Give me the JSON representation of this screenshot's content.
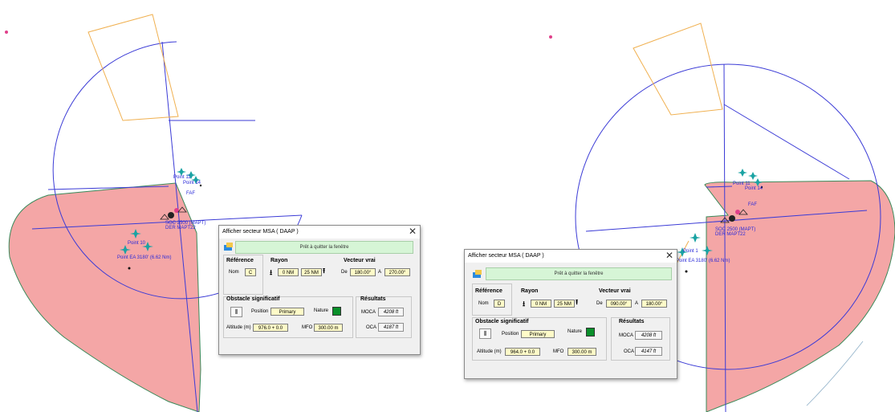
{
  "map": {
    "labels": {
      "point_11": "Point 11",
      "point_10": "Point 10",
      "point_1": "Point 1",
      "faf": "FAF",
      "soc": "SOC 2500 (MAPT)",
      "soc_sub": "DER MAPT22",
      "point_14": "Point 14",
      "pt_short": "Point 1",
      "ea_left": "Point EA 3180' (6.62 Nm)",
      "ea_right": "Point EA 3180' (6.62 Nm)"
    }
  },
  "left_dialog": {
    "title": "Afficher secteur MSA ( DAAP )",
    "close": "✕",
    "status": "Prêt à quitter la fenêtre",
    "reference": {
      "heading": "Référence",
      "nom_label": "Nom",
      "nom_value": "C"
    },
    "rayon": {
      "heading": "Rayon",
      "from": "0 NM",
      "to": "25 NM"
    },
    "vecteur": {
      "heading": "Vecteur vrai",
      "de_label": "De",
      "de_value": "180.00°",
      "a_label": "A",
      "a_value": "270.00°"
    },
    "obstacle": {
      "heading": "Obstacle significatif",
      "position_label": "Position",
      "position_value": "Primary",
      "nature_label": "Nature",
      "altitude_label": "Altitude (m)",
      "altitude_value": "976.0 + 0.0",
      "mfo_label": "MFO",
      "mfo_value": "300.00 m"
    },
    "resultats": {
      "heading": "Résultats",
      "moca_label": "MOCA",
      "moca_value": "4208 ft",
      "oca_label": "OCA",
      "oca_value": "4187 ft"
    }
  },
  "right_dialog": {
    "title": "Afficher secteur MSA ( DAAP )",
    "close": "✕",
    "status": "Prêt à quitter la fenêtre",
    "reference": {
      "heading": "Référence",
      "nom_label": "Nom",
      "nom_value": "D"
    },
    "rayon": {
      "heading": "Rayon",
      "from": "0 NM",
      "to": "25 NM"
    },
    "vecteur": {
      "heading": "Vecteur vrai",
      "de_label": "De",
      "de_value": "090.00°",
      "a_label": "A",
      "a_value": "180.00°"
    },
    "obstacle": {
      "heading": "Obstacle significatif",
      "position_label": "Position",
      "position_value": "Primary",
      "nature_label": "Nature",
      "altitude_label": "Altitude (m)",
      "altitude_value": "964.0 + 0.0",
      "mfo_label": "MFO",
      "mfo_value": "300.00 m"
    },
    "resultats": {
      "heading": "Résultats",
      "moca_label": "MOCA",
      "moca_value": "4208 ft",
      "oca_label": "OCA",
      "oca_value": "4147 ft"
    }
  },
  "colors": {
    "sector": "#f4a6a6",
    "sector_edge": "#3a8a5a",
    "lines": "#3b3bd6",
    "fix_arc": "#f0b050",
    "marker": "#1aa3a3"
  }
}
